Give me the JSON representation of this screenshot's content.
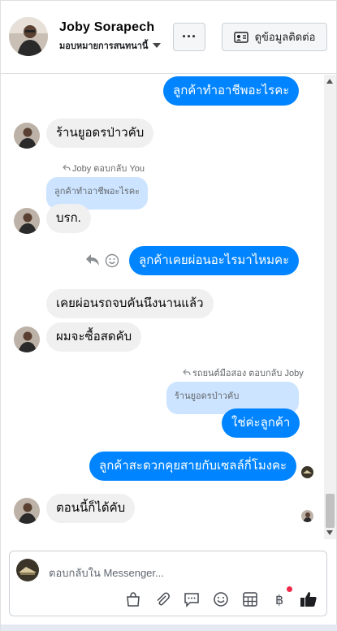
{
  "header": {
    "name": "Joby Sorapech",
    "subtitle": "มอบหมายการสนทนานี้",
    "more_label": "···",
    "contact_label": "ดูข้อมูลติดต่อ"
  },
  "messages": {
    "m1": "ลูกค้าทำอาชีพอะไรคะ",
    "m2": "ร้านยูอดรป่าวคับ",
    "m3_reply_label": "Joby ตอบกลับ You",
    "m3_quote": "ลูกค้าทำอาชีพอะไรคะ",
    "m3": "บรก.",
    "m4": "ลูกค้าเคยผ่อนอะไรมาไหมคะ",
    "m5": "เคยผ่อนรถจบคันนึงนานแล้ว",
    "m6": "ผมจะซื้อสดคับ",
    "m7_reply_label": "รถยนต์มือสอง ตอบกลับ Joby",
    "m7_quote": "ร้านยูอดรป่าวคับ",
    "m7": "ใช่ค่ะลูกค้า",
    "m8": "ลูกค้าสะดวกคุยสายกับเซลล์กี่โมงคะ",
    "m9": "ตอนนี้ก็ได้คับ"
  },
  "composer": {
    "placeholder": "ตอบกลับใน Messenger..."
  },
  "colors": {
    "outgoing": "#0084ff",
    "incoming": "#f0f0f0",
    "quote": "#cce4ff",
    "like": "#1c1e21"
  }
}
